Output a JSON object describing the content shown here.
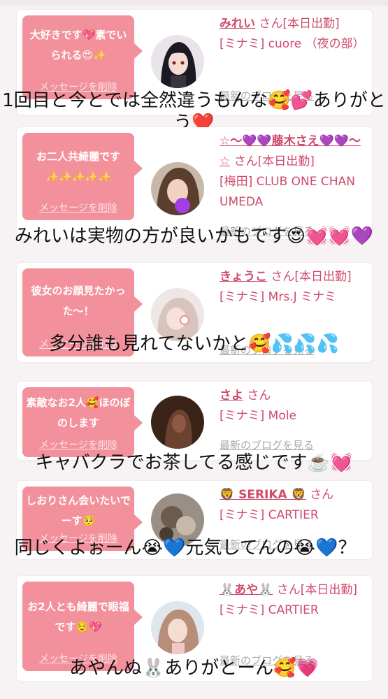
{
  "cards": [
    {
      "message": "大好きです💖素でいられる😍✨",
      "delete_label": "メッセージを削除",
      "name": "みれい",
      "suffix": "さん[本日出勤]",
      "shop": "[ミナミ] cuore （夜の部）",
      "blog_label": "最新のブログを見る",
      "comment": "1回目と今とでは全然違うもんな🥰💕ありがとう❤️"
    },
    {
      "message": "お二人共綺麗です✨✨✨✨✨",
      "delete_label": "メッセージを削除",
      "name": "☆〜💜💜藤木さえ💜💜〜☆",
      "suffix": "さん[本日出勤]",
      "shop": "[梅田] CLUB ONE CHAN UMEDA",
      "blog_label": "最新のブログを見る",
      "comment": "みれいは実物の方が良いかもです😍💓💓💜"
    },
    {
      "message": "彼女のお顔見たかった〜！",
      "delete_label": "メッセージを削除",
      "name": "きょうこ",
      "suffix": "さん[本日出勤]",
      "shop": "[ミナミ] Mrs.J ミナミ",
      "blog_label": "最新のブログを見る",
      "comment": "多分誰も見れてないかと🥰💦💦💦"
    },
    {
      "message": "素敵なお2人🥰ほのぼのします",
      "delete_label": "メッセージを削除",
      "name": "さよ",
      "suffix": "さん",
      "shop": "[ミナミ] Mole",
      "blog_label": "最新のブログを見る",
      "comment": "キャバクラでお茶してる感じです☕️💓"
    },
    {
      "message": "しおりさん会いたいでーす🥺",
      "delete_label": "メッセージを削除",
      "name": "🦁 SERIKA 🦁",
      "suffix": "さん",
      "shop": "[ミナミ] CARTIER",
      "blog_label": "最新のブログを見る",
      "comment": "同じくよぉーん😭💙元気してんの😭💙？"
    },
    {
      "message": "お2人とも綺麗で眼福です☺️💖",
      "delete_label": "メッセージを削除",
      "name": "🐰あや🐰",
      "suffix": "さん[本日出勤]",
      "shop": "[ミナミ] CARTIER",
      "blog_label": "最新のブログを見る",
      "comment": "あやんぬ🐰ありがとーん🥰💗"
    }
  ],
  "colors": {
    "bubble": "#f2909b",
    "accent_text": "#d04a6c",
    "page_bg": "#f7f2f3",
    "blog_link": "#a9a9a9"
  },
  "icons": [
    "avatar-photo"
  ]
}
